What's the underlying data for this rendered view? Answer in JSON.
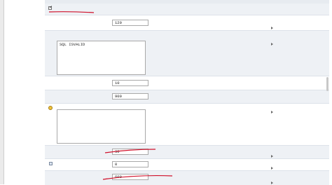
{
  "rows": [
    {
      "key": "test_connections_on_reserve",
      "label": "",
      "value": "",
      "checked": true
    },
    {
      "key": "test_frequency",
      "label": "",
      "value": "120"
    },
    {
      "key": "test_table_name",
      "label": "",
      "value": "SQL ISVALID"
    },
    {
      "key": "row4",
      "label": "",
      "value": "10"
    },
    {
      "key": "row5",
      "label": "",
      "value": "900"
    },
    {
      "key": "init_sql",
      "label": "",
      "value": ""
    },
    {
      "key": "row7",
      "label": "",
      "value": "30"
    },
    {
      "key": "row8",
      "label": "",
      "value": "0"
    },
    {
      "key": "row9",
      "label": "",
      "value": "600"
    }
  ],
  "descriptions": {
    "d1": "",
    "d2": "",
    "d3": "",
    "d4": "",
    "d5": "",
    "d6": "",
    "d7": "",
    "d8": "",
    "d9": ""
  },
  "more_link": "",
  "colors": {
    "band": "#eef1f5",
    "link": "#1b5fb8",
    "annotation": "#d0102a"
  }
}
